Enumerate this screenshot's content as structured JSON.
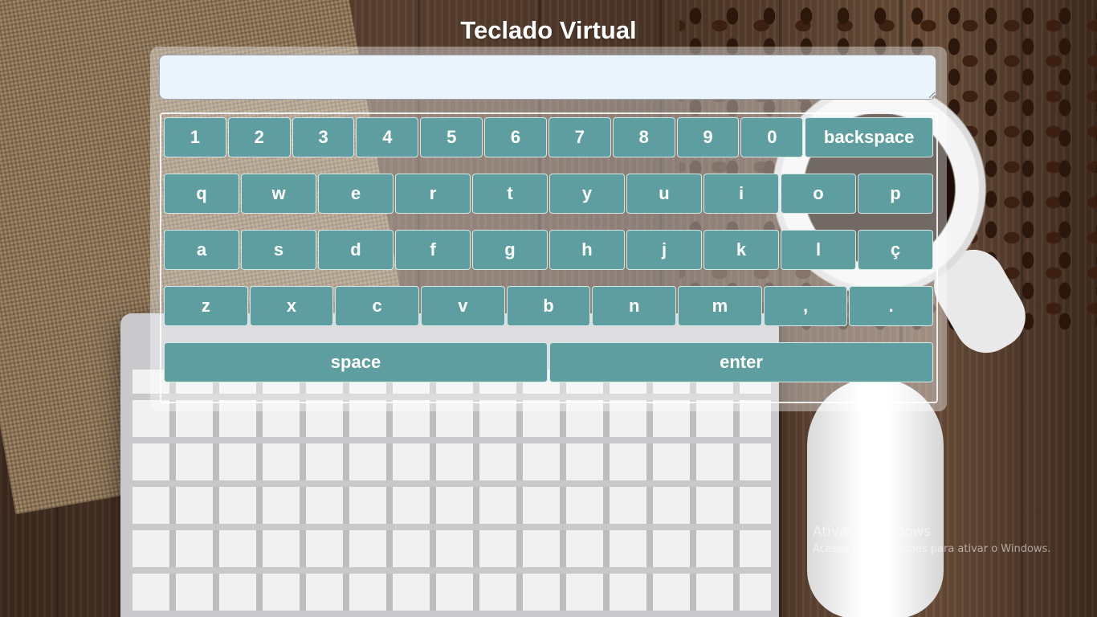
{
  "title": "Teclado Virtual",
  "input": {
    "value": "",
    "placeholder": ""
  },
  "keyboard": {
    "row1": [
      "1",
      "2",
      "3",
      "4",
      "5",
      "6",
      "7",
      "8",
      "9",
      "0",
      "backspace"
    ],
    "row2": [
      "q",
      "w",
      "e",
      "r",
      "t",
      "y",
      "u",
      "i",
      "o",
      "p"
    ],
    "row3": [
      "a",
      "s",
      "d",
      "f",
      "g",
      "h",
      "j",
      "k",
      "l",
      "ç"
    ],
    "row4": [
      "z",
      "x",
      "c",
      "v",
      "b",
      "n",
      "m",
      ",",
      "."
    ],
    "row5": [
      "space",
      "enter"
    ]
  },
  "colors": {
    "key_bg": "#5f9ea0",
    "key_text": "#ffffff",
    "textarea_bg": "#ebf5fd"
  },
  "watermark": {
    "line1": "Ativar o Windows",
    "line2": "Acesse Configurações para ativar o Windows."
  }
}
